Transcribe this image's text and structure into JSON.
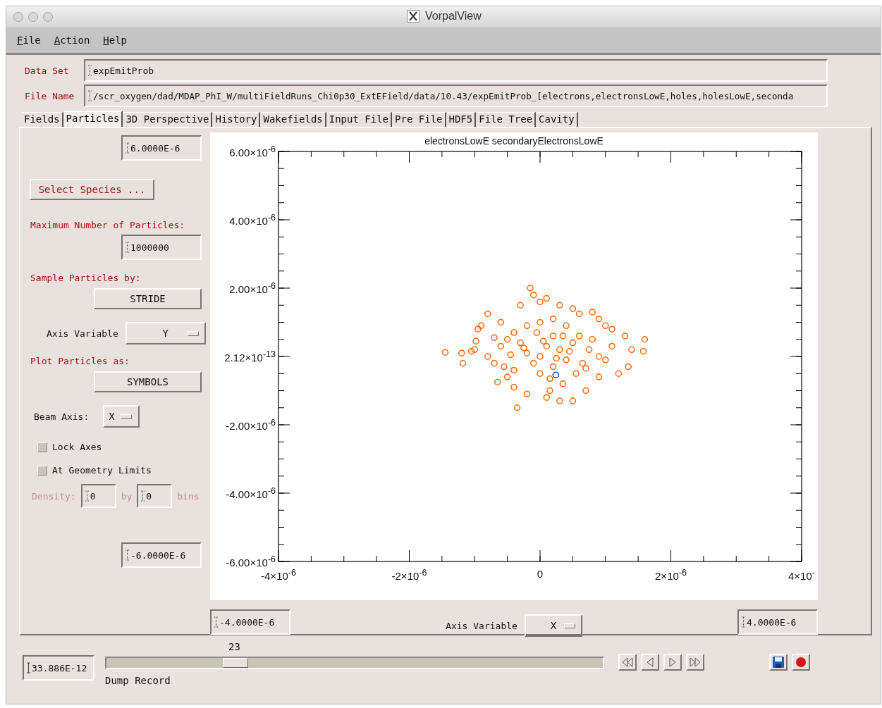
{
  "window": {
    "title": "VorpalView"
  },
  "menu": [
    "File",
    "Action",
    "Help"
  ],
  "data_set": {
    "label": "Data Set",
    "value": "expEmitProb"
  },
  "file_name": {
    "label": "File Name",
    "value": "/scr_oxygen/dad/MDAP_PhI_W/multiFieldRuns_Chi0p30_ExtEField/data/10.43/expEmitProb_[electrons,electronsLowE,holes,holesLowE,seconda"
  },
  "tabs": [
    {
      "label": "Fields",
      "selected": false
    },
    {
      "label": "Particles",
      "selected": true
    },
    {
      "label": "3D Perspective",
      "selected": false
    },
    {
      "label": "History",
      "selected": false
    },
    {
      "label": "Wakefields",
      "selected": false
    },
    {
      "label": "Input File",
      "selected": false
    },
    {
      "label": "Pre File",
      "selected": false
    },
    {
      "label": "HDF5",
      "selected": false
    },
    {
      "label": "File Tree",
      "selected": false
    },
    {
      "label": "Cavity",
      "selected": false
    }
  ],
  "particles_panel": {
    "y_max": "6.0000E-6",
    "select_species": "Select Species ...",
    "max_particles_label": "Maximum Number of Particles:",
    "max_particles": "1000000",
    "sample_label": "Sample Particles by:",
    "sample_button": "STRIDE",
    "axis_variable": {
      "label": "Axis Variable",
      "value": "Y"
    },
    "plot_as_label": "Plot Particles as:",
    "plot_as_button": "SYMBOLS",
    "beam_axis": {
      "label": "Beam Axis:",
      "value": "X"
    },
    "checkboxes": [
      {
        "label": "Lock Axes",
        "checked": false
      },
      {
        "label": "At Geometry Limits",
        "checked": false
      }
    ],
    "density": {
      "label": "Density:",
      "value_1": "0",
      "by": "by",
      "value_2": "0",
      "unit": "bins",
      "disabled": true
    },
    "y_min": "-6.0000E-6"
  },
  "plot": {
    "chart_data": {
      "type": "scatter",
      "title": "electronsLowE secondaryElectronsLowE",
      "xlim": [
        -4e-06,
        4e-06
      ],
      "ylim": [
        -6e-06,
        6e-06
      ],
      "xticks": [
        {
          "value": -4e-06,
          "label": "-4×10$^{-6}$"
        },
        {
          "value": -2e-06,
          "label": "-2×10$^{-6}$"
        },
        {
          "value": 0,
          "label": "0"
        },
        {
          "value": 2e-06,
          "label": "2×10$^{-6}$"
        },
        {
          "value": 4e-06,
          "label": "4×10$^{-}$"
        }
      ],
      "yticks": [
        {
          "value": 6e-06,
          "label": "6.00×10$^{-6}$"
        },
        {
          "value": 4e-06,
          "label": "4.00×10$^{-6}$"
        },
        {
          "value": 2e-06,
          "label": "2.00×10$^{-6}$"
        },
        {
          "value": 0,
          "label": "2.12×10$^{-13}$"
        },
        {
          "value": -2e-06,
          "label": "-2.00×10$^{-6}$"
        },
        {
          "value": -4e-06,
          "label": "-4.00×10$^{-6}$"
        },
        {
          "value": -6e-06,
          "label": "-6.00×10$^{-6}$"
        }
      ],
      "series": [
        {
          "color": "#ff6600",
          "x": [
            -1.45e-06,
            -1.2e-06,
            -1.18e-06,
            -1.05e-06,
            -1e-06,
            -9.8e-07,
            -9.5e-07,
            -9e-07,
            -8e-07,
            -7e-07,
            -6e-07,
            -5.5e-07,
            -5e-07,
            -4e-07,
            -3.5e-07,
            -2e-07,
            -3e-07,
            -1.5e-07,
            -1e-07,
            0.0,
            1e-07,
            3e-07,
            5e-07,
            6e-07,
            8e-07,
            9e-07,
            1e-06,
            1.1e-06,
            1.3e-06,
            1.4e-06,
            1.6e-06,
            1.58e-06,
            1.35e-06,
            1.2e-06,
            1e-06,
            9e-07,
            7e-07,
            5e-07,
            3e-07,
            1e-07,
            1.5e-07,
            3.5e-07,
            5.5e-07,
            6.5e-07,
            7.5e-07,
            6e-07,
            4e-07,
            2e-07,
            0.0,
            -2e-07,
            -4e-07,
            -3e-07,
            -2e-07,
            -1e-07,
            0.0,
            1e-07,
            2e-07,
            3e-07,
            4e-07,
            5e-07,
            -5e-07,
            -6e-07,
            -7e-07,
            0.0,
            2e-07,
            -4e-07,
            8e-07,
            9e-07,
            -8e-07,
            1.1e-06,
            -2.5e-07,
            5e-08,
            2.5e-07,
            4.5e-07,
            -4.5e-07,
            1.5e-07,
            -5e-08,
            3.5e-07,
            7e-07,
            -6.5e-07
          ],
          "values": [
            1.2e-07,
            1e-07,
            -2e-07,
            1.5e-07,
            2e-07,
            4.5e-07,
            8e-07,
            9e-07,
            1.25e-06,
            5.5e-07,
            3e-07,
            -3e-07,
            -6e-07,
            -9e-07,
            -1.5e-06,
            -1.1e-06,
            1.5e-06,
            2e-06,
            1.8e-06,
            1.6e-06,
            1.7e-06,
            1.5e-06,
            1.4e-06,
            1.25e-06,
            1.3e-06,
            1.1e-06,
            9e-07,
            8e-07,
            6e-07,
            2e-07,
            5e-07,
            1.5e-07,
            -3e-07,
            -5e-07,
            -1e-07,
            -6e-07,
            -1e-06,
            -1.3e-06,
            -1.3e-06,
            -1.2e-06,
            -1e-06,
            -8e-07,
            -5e-07,
            -2e-07,
            2e-07,
            6e-07,
            9e-07,
            1.1e-06,
            1e-06,
            9e-07,
            7e-07,
            4e-07,
            1e-07,
            -2e-07,
            -5e-07,
            3e-07,
            6e-07,
            2e-07,
            -1e-07,
            4e-07,
            5e-07,
            1e-06,
            -2e-07,
            0.0,
            -3e-07,
            -4e-07,
            5e-07,
            0.0,
            0.0,
            3e-07,
            2.5e-07,
            4.5e-07,
            -5e-08,
            1.5e-07,
            5e-08,
            -6.5e-07,
            7e-07,
            6e-07,
            -3.5e-07,
            -7.5e-07
          ]
        },
        {
          "color": "#2040c0",
          "x": [
            2.4e-07
          ],
          "values": [
            -5.4e-07
          ]
        }
      ]
    }
  },
  "x_axis_controls": {
    "x_min": "-4.0000E-6",
    "axis_variable": {
      "label": "Axis Variable",
      "value": "X"
    },
    "x_max": "4.0000E-6"
  },
  "playback": {
    "time": "33.886E-12",
    "dump_value": "23",
    "level": 0.26,
    "dump_label": "Dump Record"
  }
}
